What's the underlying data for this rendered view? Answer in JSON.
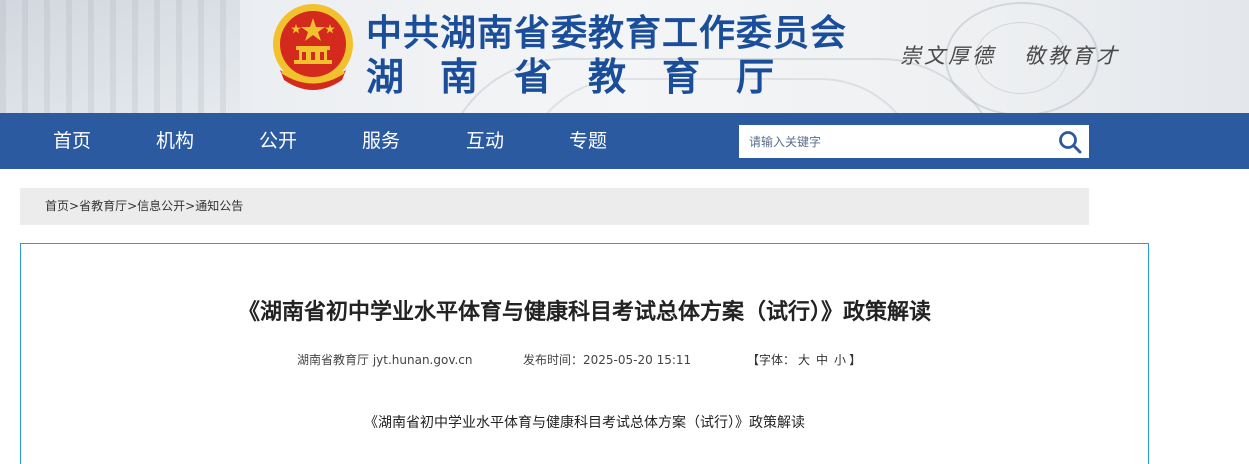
{
  "header": {
    "title_line1": "中共湖南省委教育工作委员会",
    "title_line2": "湖南省教育厅",
    "motto_left": "崇文厚德",
    "motto_right": "敬教育才",
    "emblem_icon": "national-emblem-icon",
    "colors": {
      "title": "#1b4e9a",
      "emblem_red": "#d42a1e",
      "emblem_gold": "#f2c12e"
    }
  },
  "nav": {
    "items": [
      {
        "label": "首页"
      },
      {
        "label": "机构"
      },
      {
        "label": "公开"
      },
      {
        "label": "服务"
      },
      {
        "label": "互动"
      },
      {
        "label": "专题"
      }
    ],
    "search": {
      "placeholder": "请输入关键字",
      "icon": "search-icon"
    },
    "colors": {
      "background": "#2b5aa0",
      "text": "#ffffff"
    }
  },
  "breadcrumb": {
    "items": [
      "首页",
      "省教育厅",
      "信息公开",
      "通知公告"
    ],
    "separator": ">"
  },
  "article": {
    "title": "《湖南省初中学业水平体育与健康科目考试总体方案（试行）》政策解读",
    "source": "湖南省教育厅 jyt.hunan.gov.cn",
    "publish_label": "发布时间：",
    "publish_time": "2025-05-20 15:11",
    "fontsize": {
      "open": "【字体：",
      "large": "大",
      "medium": "中",
      "small": "小",
      "close": "】"
    },
    "subtitle": "《湖南省初中学业水平体育与健康科目考试总体方案（试行）》政策解读",
    "colors": {
      "border": "#2b9fd9"
    }
  }
}
